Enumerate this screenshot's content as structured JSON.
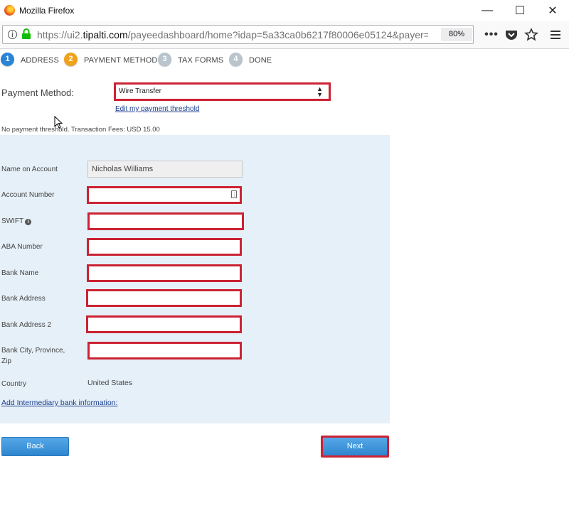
{
  "window": {
    "title": "Mozilla Firefox",
    "controls": {
      "minimize": "—",
      "maximize": "☐",
      "close": "✕"
    }
  },
  "browser": {
    "url_scheme": "https://ui2.",
    "url_host": "tipalti.com",
    "url_path": "/payeedashboard/home?idap=5a33ca0b6217f80006e05124&payer=",
    "zoom": "80%",
    "icons": [
      "info-icon",
      "lock-icon",
      "more-actions-icon",
      "pocket-icon",
      "bookmark-star-icon",
      "menu-icon"
    ]
  },
  "steps": [
    {
      "number": "1",
      "label": "ADDRESS",
      "state": "complete",
      "color": "#2a84d6"
    },
    {
      "number": "2",
      "label": "PAYMENT METHOD",
      "state": "current",
      "color": "#f0a21a"
    },
    {
      "number": "3",
      "label": "TAX FORMS",
      "state": "pending",
      "color": "#b9c4cc"
    },
    {
      "number": "4",
      "label": "DONE",
      "state": "pending",
      "color": "#b9c4cc"
    }
  ],
  "payment": {
    "label": "Payment Method:",
    "selected": "Wire Transfer",
    "threshold_link": "Edit my payment threshold",
    "fees_text": "No payment threshold. Transaction Fees: USD 15.00"
  },
  "form": {
    "name_on_account": {
      "label": "Name on Account",
      "value": "Nicholas Williams"
    },
    "account_number": {
      "label": "Account Number",
      "value": ""
    },
    "swift": {
      "label": "SWIFT",
      "value": ""
    },
    "aba_number": {
      "label": "ABA Number",
      "value": ""
    },
    "bank_name": {
      "label": "Bank Name",
      "value": ""
    },
    "bank_address": {
      "label": "Bank Address",
      "value": ""
    },
    "bank_address_2": {
      "label": "Bank Address 2",
      "value": ""
    },
    "bank_city": {
      "label_line1": "Bank City, Province,",
      "label_line2": "Zip",
      "value": ""
    },
    "country": {
      "label": "Country",
      "value": "United States"
    },
    "intermediary_link": "Add Intermediary bank information:"
  },
  "buttons": {
    "back": "Back",
    "next": "Next"
  },
  "colors": {
    "highlight": "#cc2233",
    "panel_bg": "#e6f0f8",
    "button_blue": "#2f86cf",
    "link": "#1a3d8f"
  }
}
